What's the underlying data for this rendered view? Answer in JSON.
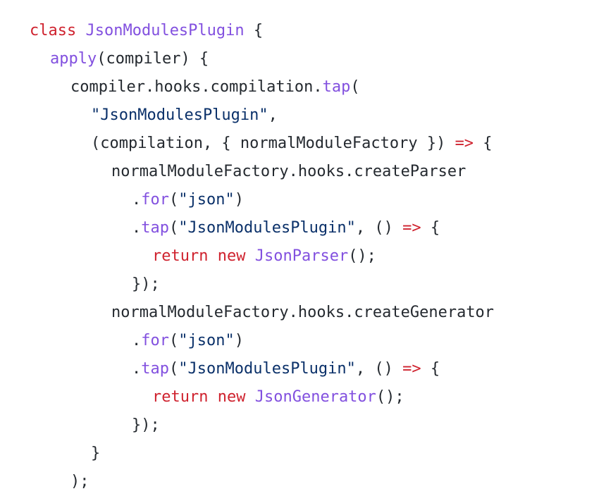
{
  "editor": {
    "colors": {
      "background": "#ffffff",
      "plain": "#24292f",
      "keyword": "#cf222e",
      "function": "#8250df",
      "string": "#0a3069"
    },
    "lines": [
      {
        "indent": 0,
        "tokens": [
          {
            "t": "keyword",
            "v": "class"
          },
          {
            "t": "plain",
            "v": " "
          },
          {
            "t": "function",
            "v": "JsonModulesPlugin"
          },
          {
            "t": "plain",
            "v": " {"
          }
        ]
      },
      {
        "indent": 1,
        "tokens": [
          {
            "t": "function",
            "v": "apply"
          },
          {
            "t": "plain",
            "v": "(compiler) {"
          }
        ]
      },
      {
        "indent": 2,
        "tokens": [
          {
            "t": "plain",
            "v": "compiler.hooks.compilation."
          },
          {
            "t": "function",
            "v": "tap"
          },
          {
            "t": "plain",
            "v": "("
          }
        ]
      },
      {
        "indent": 3,
        "tokens": [
          {
            "t": "string",
            "v": "\"JsonModulesPlugin\""
          },
          {
            "t": "plain",
            "v": ","
          }
        ]
      },
      {
        "indent": 3,
        "tokens": [
          {
            "t": "plain",
            "v": "(compilation, { normalModuleFactory }) "
          },
          {
            "t": "keyword",
            "v": "=>"
          },
          {
            "t": "plain",
            "v": " {"
          }
        ]
      },
      {
        "indent": 4,
        "tokens": [
          {
            "t": "plain",
            "v": "normalModuleFactory.hooks.createParser"
          }
        ]
      },
      {
        "indent": 5,
        "tokens": [
          {
            "t": "plain",
            "v": "."
          },
          {
            "t": "function",
            "v": "for"
          },
          {
            "t": "plain",
            "v": "("
          },
          {
            "t": "string",
            "v": "\"json\""
          },
          {
            "t": "plain",
            "v": ")"
          }
        ]
      },
      {
        "indent": 5,
        "tokens": [
          {
            "t": "plain",
            "v": "."
          },
          {
            "t": "function",
            "v": "tap"
          },
          {
            "t": "plain",
            "v": "("
          },
          {
            "t": "string",
            "v": "\"JsonModulesPlugin\""
          },
          {
            "t": "plain",
            "v": ", () "
          },
          {
            "t": "keyword",
            "v": "=>"
          },
          {
            "t": "plain",
            "v": " {"
          }
        ]
      },
      {
        "indent": 6,
        "tokens": [
          {
            "t": "keyword",
            "v": "return"
          },
          {
            "t": "plain",
            "v": " "
          },
          {
            "t": "keyword",
            "v": "new"
          },
          {
            "t": "plain",
            "v": " "
          },
          {
            "t": "function",
            "v": "JsonParser"
          },
          {
            "t": "plain",
            "v": "();"
          }
        ]
      },
      {
        "indent": 5,
        "tokens": [
          {
            "t": "plain",
            "v": "});"
          }
        ]
      },
      {
        "indent": 4,
        "tokens": [
          {
            "t": "plain",
            "v": "normalModuleFactory.hooks.createGenerator"
          }
        ]
      },
      {
        "indent": 5,
        "tokens": [
          {
            "t": "plain",
            "v": "."
          },
          {
            "t": "function",
            "v": "for"
          },
          {
            "t": "plain",
            "v": "("
          },
          {
            "t": "string",
            "v": "\"json\""
          },
          {
            "t": "plain",
            "v": ")"
          }
        ]
      },
      {
        "indent": 5,
        "tokens": [
          {
            "t": "plain",
            "v": "."
          },
          {
            "t": "function",
            "v": "tap"
          },
          {
            "t": "plain",
            "v": "("
          },
          {
            "t": "string",
            "v": "\"JsonModulesPlugin\""
          },
          {
            "t": "plain",
            "v": ", () "
          },
          {
            "t": "keyword",
            "v": "=>"
          },
          {
            "t": "plain",
            "v": " {"
          }
        ]
      },
      {
        "indent": 6,
        "tokens": [
          {
            "t": "keyword",
            "v": "return"
          },
          {
            "t": "plain",
            "v": " "
          },
          {
            "t": "keyword",
            "v": "new"
          },
          {
            "t": "plain",
            "v": " "
          },
          {
            "t": "function",
            "v": "JsonGenerator"
          },
          {
            "t": "plain",
            "v": "();"
          }
        ]
      },
      {
        "indent": 5,
        "tokens": [
          {
            "t": "plain",
            "v": "});"
          }
        ]
      },
      {
        "indent": 3,
        "tokens": [
          {
            "t": "plain",
            "v": "}"
          }
        ]
      },
      {
        "indent": 2,
        "tokens": [
          {
            "t": "plain",
            "v": ");"
          }
        ]
      }
    ]
  }
}
